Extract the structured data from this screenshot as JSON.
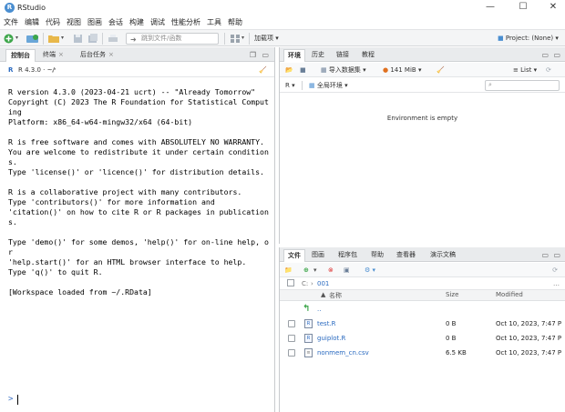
{
  "window": {
    "title": "RStudio",
    "logo_letter": "R",
    "minimize": "—",
    "maximize": "☐",
    "close": "✕"
  },
  "menu": [
    "文件",
    "编辑",
    "代码",
    "视图",
    "图画",
    "会话",
    "构建",
    "调试",
    "性能分析",
    "工具",
    "帮助"
  ],
  "toolbar": {
    "goto_placeholder": "跳到文件/函数",
    "addins_label": "加载项",
    "project_label": "Project: (None)"
  },
  "left_pane": {
    "tabs": [
      {
        "label": "控制台",
        "active": true
      },
      {
        "label": "终端",
        "closable": true
      },
      {
        "label": "后台任务",
        "closable": true
      }
    ],
    "r_version_label": "R 4.3.0 · ~/",
    "console_lines": [
      "R version 4.3.0 (2023-04-21 ucrt) -- \"Already Tomorrow\"",
      "Copyright (C) 2023 The R Foundation for Statistical Computing",
      "Platform: x86_64-w64-mingw32/x64 (64-bit)",
      "",
      "R is free software and comes with ABSOLUTELY NO WARRANTY.",
      "You are welcome to redistribute it under certain conditions.",
      "Type 'license()' or 'licence()' for distribution details.",
      "",
      "R is a collaborative project with many contributors.",
      "Type 'contributors()' for more information and",
      "'citation()' on how to cite R or R packages in publications.",
      "",
      "Type 'demo()' for some demos, 'help()' for on-line help, or",
      "'help.start()' for an HTML browser interface to help.",
      "Type 'q()' to quit R.",
      "",
      "[Workspace loaded from ~/.RData]"
    ],
    "prompt": ">"
  },
  "env_pane": {
    "tabs": [
      {
        "label": "环境",
        "active": true
      },
      {
        "label": "历史"
      },
      {
        "label": "链接"
      },
      {
        "label": "教程"
      }
    ],
    "import_label": "导入数据集",
    "memory_label": "141 MiB",
    "list_label": "List",
    "lang_label": "R",
    "scope_label": "全局环境",
    "empty_message": "Environment is empty"
  },
  "files_pane": {
    "tabs": [
      {
        "label": "文件",
        "active": true
      },
      {
        "label": "图画"
      },
      {
        "label": "程序包"
      },
      {
        "label": "帮助"
      },
      {
        "label": "查看器"
      },
      {
        "label": "演示文稿"
      }
    ],
    "path": [
      "C:",
      "001"
    ],
    "columns": {
      "name": "名称",
      "size": "Size",
      "modified": "Modified"
    },
    "up_label": "..",
    "files": [
      {
        "name": "test.R",
        "size": "0 B",
        "modified": "Oct 10, 2023, 7:47 P"
      },
      {
        "name": "guiplot.R",
        "size": "0 B",
        "modified": "Oct 10, 2023, 7:47 P"
      },
      {
        "name": "nonmem_cn.csv",
        "size": "6.5 KB",
        "modified": "Oct 10, 2023, 7:47 P"
      }
    ]
  }
}
